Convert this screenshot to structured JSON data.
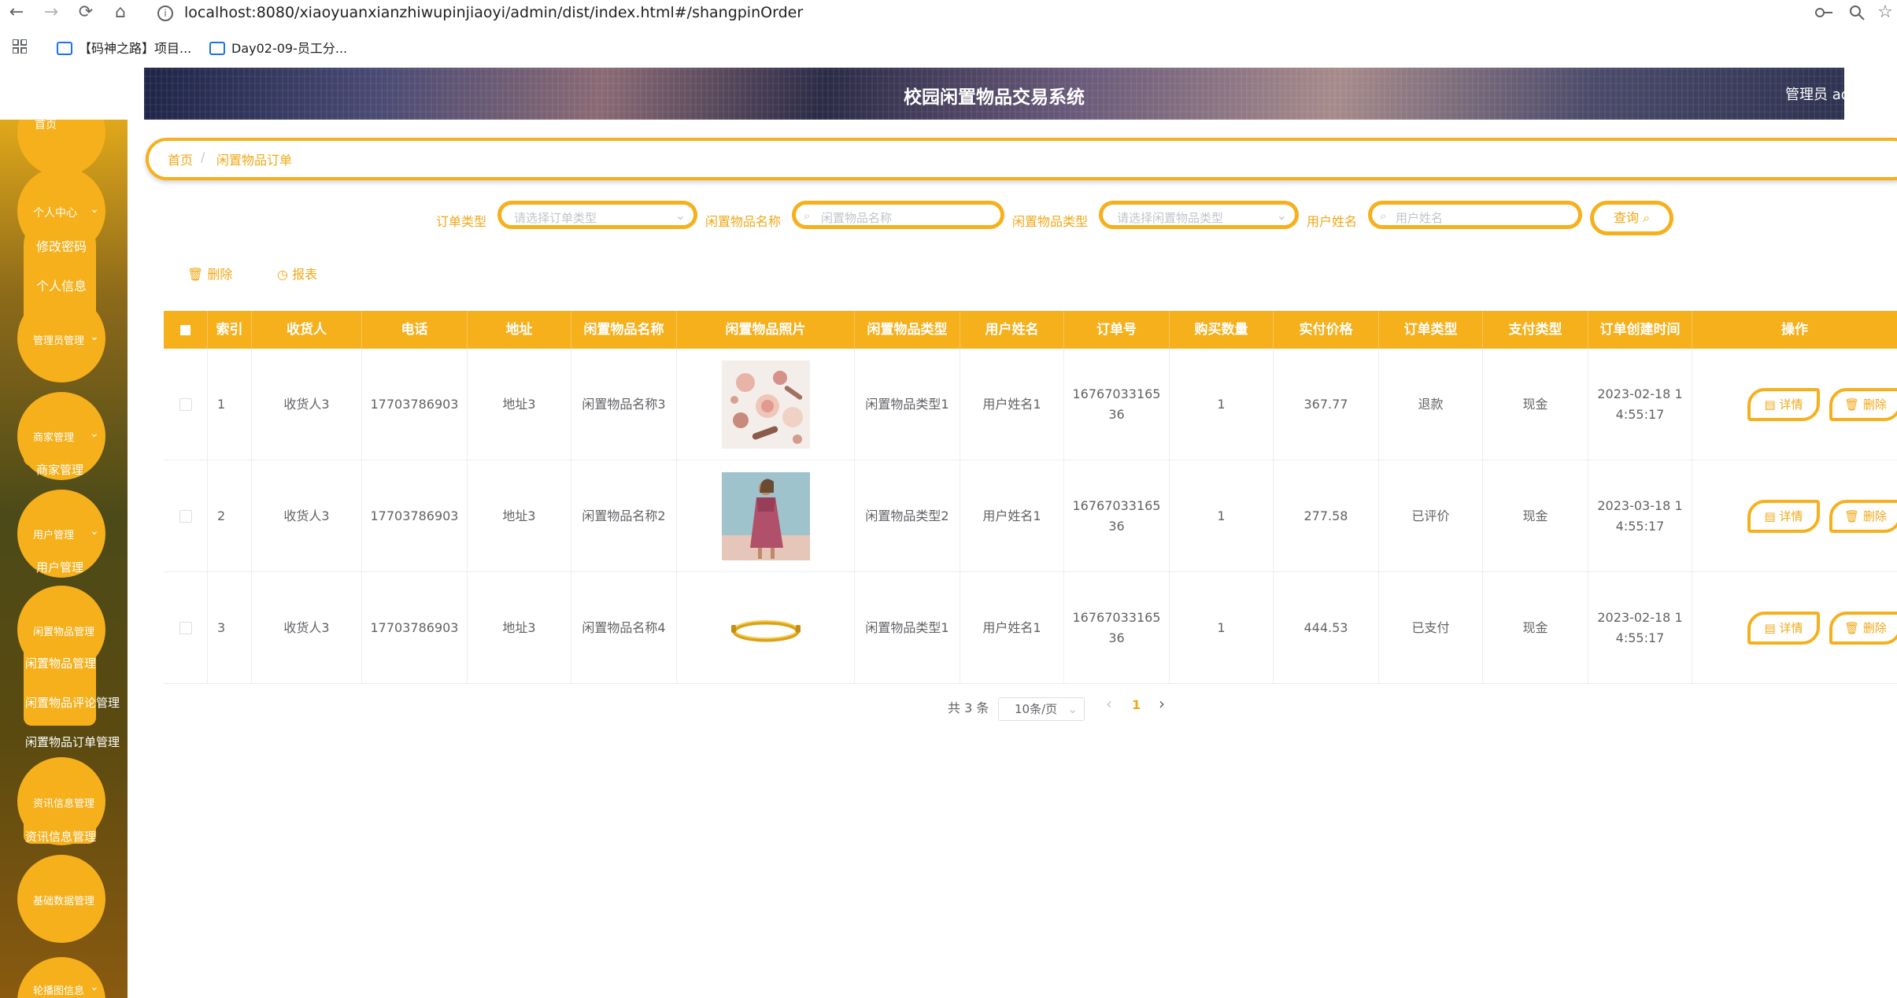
{
  "browser": {
    "back": "←",
    "forward": "→",
    "reload": "⟳",
    "home": "⌂",
    "url": "localhost:8080/xiaoyuanxianzhiwupinjiaoyi/admin/dist/index.html#/shangpinOrder",
    "bookmarks": [
      "【码神之路】项目...",
      "Day02-09-员工分..."
    ]
  },
  "header": {
    "title": "校园闲置物品交易系统",
    "user": "管理员 ad"
  },
  "sidebar": {
    "items": [
      {
        "label": "首页"
      },
      {
        "label": "个人中心",
        "children": [
          "修改密码",
          "个人信息"
        ]
      },
      {
        "label": "管理员管理"
      },
      {
        "label": "商家管理",
        "children": [
          "商家管理"
        ]
      },
      {
        "label": "用户管理",
        "children": [
          "用户管理"
        ]
      },
      {
        "label": "闲置物品管理",
        "children": [
          "闲置物品管理",
          "闲置物品评论管理",
          "闲置物品订单管理"
        ]
      },
      {
        "label": "资讯信息管理",
        "children": [
          "资讯信息管理"
        ]
      },
      {
        "label": "基础数据管理"
      },
      {
        "label": "轮播图信息"
      }
    ]
  },
  "breadcrumb": {
    "home": "首页",
    "separator": "/",
    "current": "闲置物品订单"
  },
  "search": {
    "order_type_label": "订单类型",
    "order_type_placeholder": "请选择订单类型",
    "item_name_label": "闲置物品名称",
    "item_name_placeholder": "闲置物品名称",
    "item_type_label": "闲置物品类型",
    "item_type_placeholder": "请选择闲置物品类型",
    "user_name_label": "用户姓名",
    "user_name_placeholder": "用户姓名",
    "query_button": "查询"
  },
  "toolbar": {
    "delete_label": "删除",
    "report_label": "报表"
  },
  "table": {
    "columns": [
      "索引",
      "收货人",
      "电话",
      "地址",
      "闲置物品名称",
      "闲置物品照片",
      "闲置物品类型",
      "用户姓名",
      "订单号",
      "购买数量",
      "实付价格",
      "订单类型",
      "支付类型",
      "订单创建时间",
      "操作"
    ],
    "rows": [
      {
        "index": "1",
        "receiver": "收货人3",
        "phone": "17703786903",
        "address": "地址3",
        "item_name": "闲置物品名称3",
        "photo": "cosmetics",
        "item_type": "闲置物品类型1",
        "user_name": "用户姓名1",
        "order_no_1": "16767033165",
        "order_no_2": "36",
        "quantity": "1",
        "price": "367.77",
        "order_type": "退款",
        "pay_type": "现金",
        "created_1": "2023-02-18 1",
        "created_2": "4:55:17"
      },
      {
        "index": "2",
        "receiver": "收货人3",
        "phone": "17703786903",
        "address": "地址3",
        "item_name": "闲置物品名称2",
        "photo": "dress",
        "item_type": "闲置物品类型2",
        "user_name": "用户姓名1",
        "order_no_1": "16767033165",
        "order_no_2": "36",
        "quantity": "1",
        "price": "277.58",
        "order_type": "已评价",
        "pay_type": "现金",
        "created_1": "2023-03-18 1",
        "created_2": "4:55:17"
      },
      {
        "index": "3",
        "receiver": "收货人3",
        "phone": "17703786903",
        "address": "地址3",
        "item_name": "闲置物品名称4",
        "photo": "bracelet",
        "item_type": "闲置物品类型1",
        "user_name": "用户姓名1",
        "order_no_1": "16767033165",
        "order_no_2": "36",
        "quantity": "1",
        "price": "444.53",
        "order_type": "已支付",
        "pay_type": "现金",
        "created_1": "2023-02-18 1",
        "created_2": "4:55:17"
      }
    ],
    "detail_button": "详情",
    "delete_button": "删除"
  },
  "pagination": {
    "total": "共 3 条",
    "page_size": "10条/页",
    "current_page": "1",
    "prev": "‹",
    "next": "›"
  },
  "colors": {
    "accent": "#f5b01c",
    "accent_text": "#f0a818"
  }
}
